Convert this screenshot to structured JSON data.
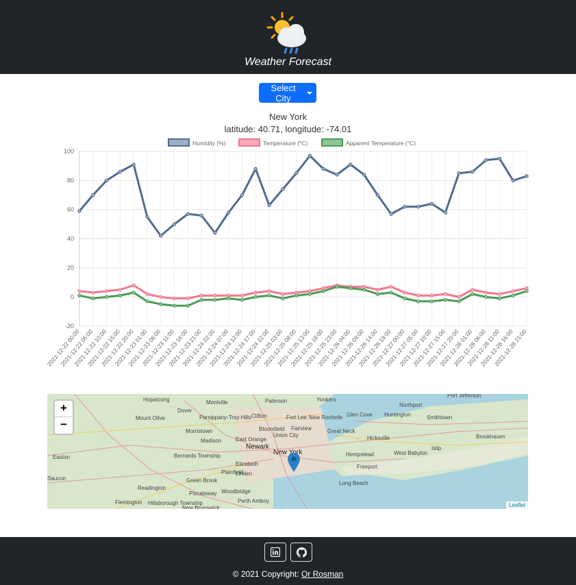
{
  "header": {
    "title": "Weather Forecast",
    "logo_icon": "sun-cloud-rain-icon"
  },
  "city_select": {
    "label": "Select City"
  },
  "location": {
    "name": "New York",
    "coords": "latitude: 40.71, longitude: -74.01"
  },
  "chart_data": {
    "type": "line",
    "ylim": [
      -20,
      100
    ],
    "yticks": [
      "100",
      "80",
      "60",
      "40",
      "20",
      "0",
      "-20"
    ],
    "x": [
      "2021-12-22 00:00",
      "2021-12-22 05:00",
      "2021-12-22 10:00",
      "2021-12-22 15:00",
      "2021-12-22 20:00",
      "2021-12-23 01:00",
      "2021-12-23 06:00",
      "2021-12-23 11:00",
      "2021-12-23 16:00",
      "2021-12-23 21:00",
      "2021-12-24 02:00",
      "2021-12-24 07:00",
      "2021-12-24 12:00",
      "2021-12-24 17:00",
      "2021-12-24 22:00",
      "2021-12-25 03:00",
      "2021-12-25 08:00",
      "2021-12-25 13:00",
      "2021-12-25 18:00",
      "2021-12-25 23:00",
      "2021-12-26 04:00",
      "2021-12-26 09:00",
      "2021-12-26 14:00",
      "2021-12-26 19:00",
      "2021-12-27 00:00",
      "2021-12-27 05:00",
      "2021-12-27 10:00",
      "2021-12-27 15:00",
      "2021-12-27 20:00",
      "2021-12-28 01:00",
      "2021-12-28 06:00",
      "2021-12-28 11:00",
      "2021-12-28 16:00",
      "2021-12-28 21:00"
    ],
    "series": [
      {
        "name": "Humidity (%)",
        "color": "#4f6c8f",
        "fill": "#9fb0c4",
        "values": [
          59,
          70,
          80,
          86,
          91,
          55,
          42,
          50,
          57,
          56,
          44,
          58,
          70,
          88,
          63,
          74,
          85,
          97,
          88,
          84,
          91,
          84,
          70,
          57,
          62,
          62,
          64,
          58,
          85,
          86,
          94,
          95,
          80,
          83
        ]
      },
      {
        "name": "Temperature (°C)",
        "color": "#f07892",
        "fill": "#f7a9b9",
        "values": [
          4,
          3,
          4,
          5,
          8,
          2,
          0,
          -1,
          -1,
          1,
          1,
          1,
          1,
          3,
          4,
          2,
          3,
          4,
          6,
          8,
          7,
          7,
          5,
          7,
          3,
          1,
          1,
          2,
          0,
          5,
          3,
          2,
          4,
          6
        ]
      },
      {
        "name": "Apparent Temperature (°C)",
        "color": "#4b9a55",
        "fill": "#8bc694",
        "values": [
          1,
          -1,
          0,
          1,
          3,
          -3,
          -5,
          -6,
          -6,
          -2,
          -2,
          -1,
          -2,
          0,
          1,
          -1,
          1,
          2,
          4,
          7,
          6,
          5,
          2,
          3,
          -1,
          -3,
          -3,
          -2,
          -3,
          2,
          0,
          -1,
          1,
          4
        ]
      }
    ]
  },
  "map": {
    "zoom_in": "+",
    "zoom_out": "−",
    "attribution": "Leaflet",
    "marker_icon": "map-marker-icon",
    "labels": [
      "Hopatcong",
      "Montville",
      "Paterson",
      "Yonkers",
      "Port Jefferson",
      "Dover",
      "Parsippany-Troy Hills",
      "Clifton",
      "New Rochelle",
      "Northport",
      "Glen Cove",
      "Huntington",
      "Mount Olive",
      "Fort Lee",
      "Smithtown",
      "Morristown",
      "Fairview",
      "Great Neck",
      "Bloomfield",
      "Madison",
      "East Orange",
      "Union City",
      "Hicksville",
      "Brookhaven",
      "Newark",
      "New York",
      "Easton",
      "Bernards Township",
      "Elizabeth",
      "Hempstead",
      "West Babylon",
      "Islip",
      "Plainfield",
      "Linden",
      "Freeport",
      "Saucon",
      "Green Brook",
      "Readington",
      "Piscataway",
      "Woodbridge",
      "Long Beach",
      "Flemington",
      "Hillsborough Township",
      "Perth Amboy",
      "New Brunswick"
    ]
  },
  "footer": {
    "copyright_prefix": "© 2021 Copyright: ",
    "author": "Or Rosman",
    "linkedin_icon": "linkedin-icon",
    "github_icon": "github-icon"
  }
}
